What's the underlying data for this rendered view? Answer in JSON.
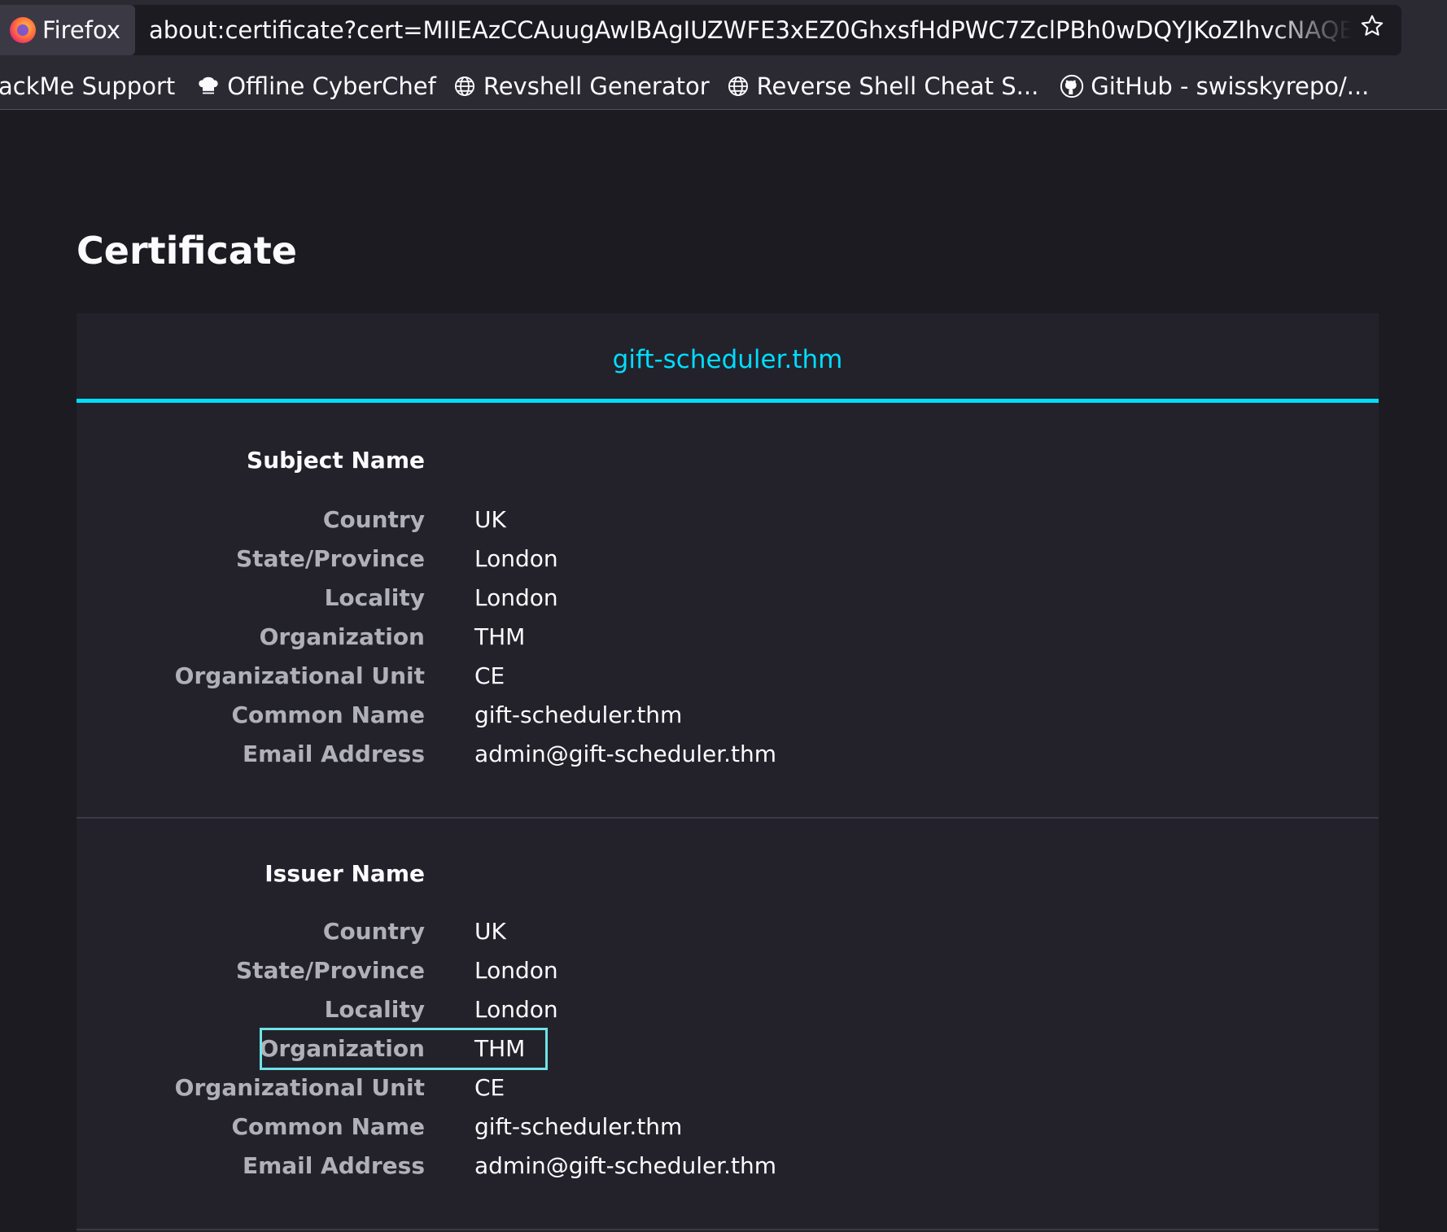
{
  "browser": {
    "identity_label": "Firefox",
    "url": "about:certificate?cert=MIIEAzCCAuugAwIBAgIUZWFE3xEZ0GhxsfHdPWC7ZclPBh0wDQYJKoZIhvcNAQELBQAwgZAxCzAJBgNVBAYTAlVL",
    "bookmarks": [
      {
        "label": "ackMe Support",
        "icon": "none"
      },
      {
        "label": "Offline CyberChef",
        "icon": "chef-hat-icon"
      },
      {
        "label": "Revshell Generator",
        "icon": "globe-icon"
      },
      {
        "label": "Reverse Shell Cheat S...",
        "icon": "globe-icon"
      },
      {
        "label": "GitHub - swisskyrepo/...",
        "icon": "github-icon"
      }
    ]
  },
  "page": {
    "title": "Certificate",
    "tab_label": "gift-scheduler.thm"
  },
  "subject": {
    "title": "Subject Name",
    "rows": [
      {
        "label": "Country",
        "value": "UK"
      },
      {
        "label": "State/Province",
        "value": "London"
      },
      {
        "label": "Locality",
        "value": "London"
      },
      {
        "label": "Organization",
        "value": "THM"
      },
      {
        "label": "Organizational Unit",
        "value": "CE"
      },
      {
        "label": "Common Name",
        "value": "gift-scheduler.thm"
      },
      {
        "label": "Email Address",
        "value": "admin@gift-scheduler.thm"
      }
    ]
  },
  "issuer": {
    "title": "Issuer Name",
    "rows": [
      {
        "label": "Country",
        "value": "UK"
      },
      {
        "label": "State/Province",
        "value": "London"
      },
      {
        "label": "Locality",
        "value": "London"
      },
      {
        "label": "Organization",
        "value": "THM"
      },
      {
        "label": "Organizational Unit",
        "value": "CE"
      },
      {
        "label": "Common Name",
        "value": "gift-scheduler.thm"
      },
      {
        "label": "Email Address",
        "value": "admin@gift-scheduler.thm"
      }
    ]
  },
  "colors": {
    "accent": "#00ddff",
    "highlight_box": "#6fe3e7",
    "page_background": "#1c1b22",
    "card_background": "#23222b"
  }
}
